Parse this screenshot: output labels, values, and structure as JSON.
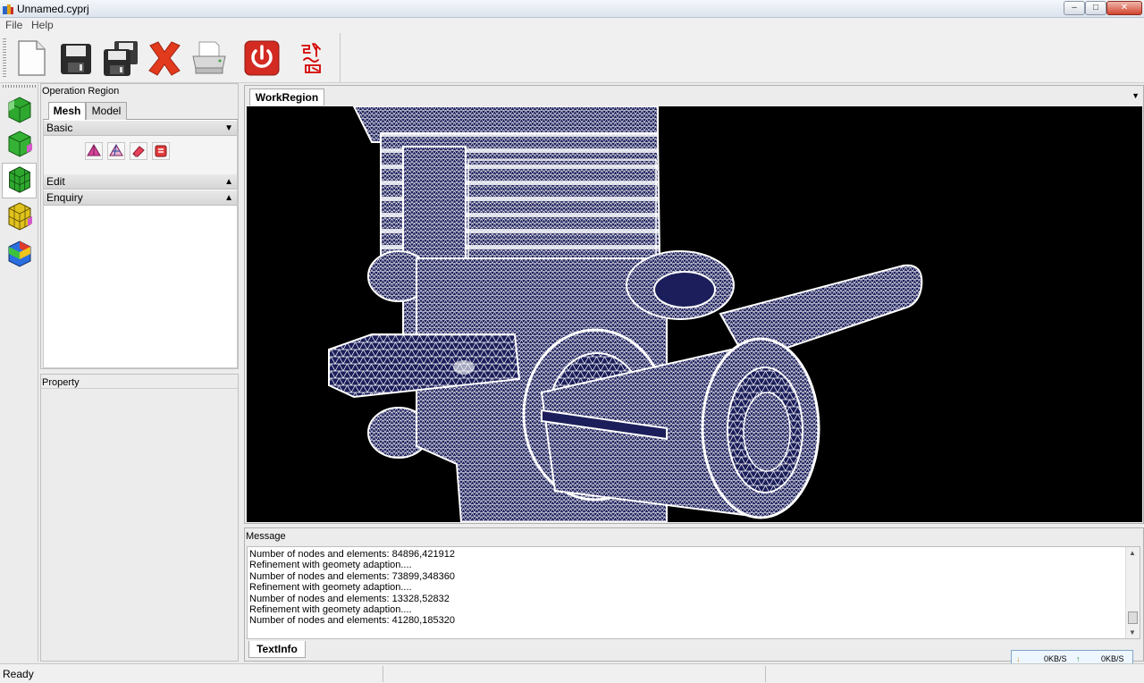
{
  "window": {
    "title": "Unnamed.cyprj"
  },
  "menu": {
    "items": [
      "File",
      "Help"
    ]
  },
  "toolbar": {
    "buttons": [
      {
        "icon": "new-file-icon"
      },
      {
        "icon": "save-icon"
      },
      {
        "icon": "save-as-icon"
      },
      {
        "icon": "delete-icon"
      },
      {
        "icon": "print-icon"
      },
      {
        "icon": "exit-icon"
      },
      {
        "icon": "signature-logo"
      }
    ],
    "colors": {
      "delete": "#e23a1c",
      "exit": "#d32b22",
      "logo": "#d40000"
    }
  },
  "modules": {
    "items": [
      {
        "icon": "module-geometry-icon"
      },
      {
        "icon": "module-surface-icon"
      },
      {
        "icon": "module-mesh-icon",
        "active": true
      },
      {
        "icon": "module-mesh-quality-icon"
      },
      {
        "icon": "module-result-icon"
      }
    ]
  },
  "operation_region": {
    "header": "Operation Region",
    "tabs": [
      {
        "label": "Mesh",
        "active": true
      },
      {
        "label": "Model",
        "active": false
      }
    ],
    "sections": [
      {
        "label": "Basic",
        "expanded": true,
        "tools": [
          "tetra-mesh-icon",
          "surface-mesh-icon",
          "eraser-icon",
          "refine-icon"
        ]
      },
      {
        "label": "Edit",
        "expanded": false
      },
      {
        "label": "Enquiry",
        "expanded": false
      }
    ]
  },
  "property": {
    "header": "Property"
  },
  "work_region": {
    "tab_label": "WorkRegion",
    "viewport_background": "#000000",
    "mesh_color": "#1b1e5a",
    "wire_color": "#ffffff"
  },
  "message": {
    "header": "Message",
    "lines": [
      "Number of nodes and elements: 84896,421912",
      "Refinement with geomety adaption....",
      "Number of nodes and elements: 73899,348360",
      "Refinement with geomety adaption....",
      "Number of nodes and elements: 13328,52832",
      "Refinement with geomety adaption....",
      "Number of nodes and elements: 41280,185320"
    ],
    "tab_label": "TextInfo"
  },
  "status": {
    "text": "Ready",
    "net_down": "0KB/S",
    "net_up": "0KB/S"
  }
}
